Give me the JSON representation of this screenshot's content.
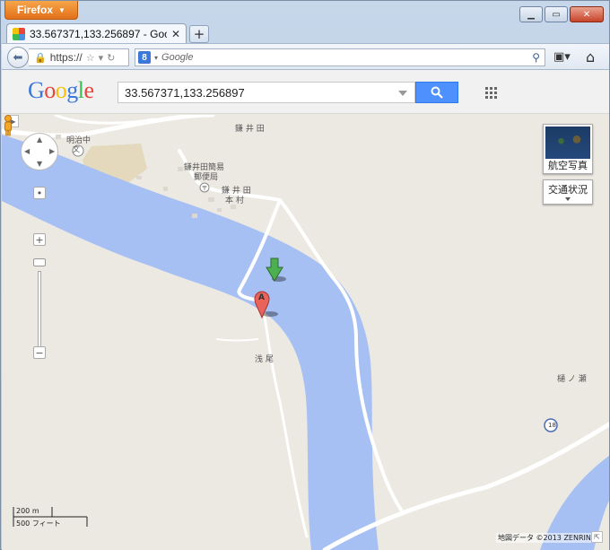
{
  "browser": {
    "app_button": "Firefox",
    "tab_title": "33.567371,133.256897 - Google マ...",
    "url": "https://",
    "search_placeholder": "Google",
    "search_engine_icon": "8"
  },
  "google": {
    "logo_letters": [
      "G",
      "o",
      "o",
      "g",
      "l",
      "e"
    ],
    "logo_colors": [
      "#3c78d8",
      "#e8453c",
      "#f4c20d",
      "#3c78d8",
      "#3cba54",
      "#e8453c"
    ],
    "query": "33.567371,133.256897"
  },
  "map": {
    "controls": {
      "satellite_label": "航空写真",
      "traffic_label": "交通状況"
    },
    "labels": {
      "meiji_school": "明治中",
      "kamaida_top": "鎌 井 田",
      "post_office_1": "鎌井田簡易",
      "post_office_2": "郵便局",
      "kamaida_honmura_1": "鎌 井 田",
      "kamaida_honmura_2": "本 村",
      "asao": "浅 尾",
      "hinose": "樋 ノ 瀬",
      "school_symbol": "文",
      "road_number": "18",
      "marker_a": "A"
    },
    "scale": {
      "metric": "200 m",
      "imperial": "500 フィート"
    },
    "copyright": "地図データ ©2013 ZENRIN -",
    "colors": {
      "water": "#a6c0f4",
      "land": "#ece8e2",
      "road": "#ffffff",
      "park": "#e4d9bd"
    }
  }
}
